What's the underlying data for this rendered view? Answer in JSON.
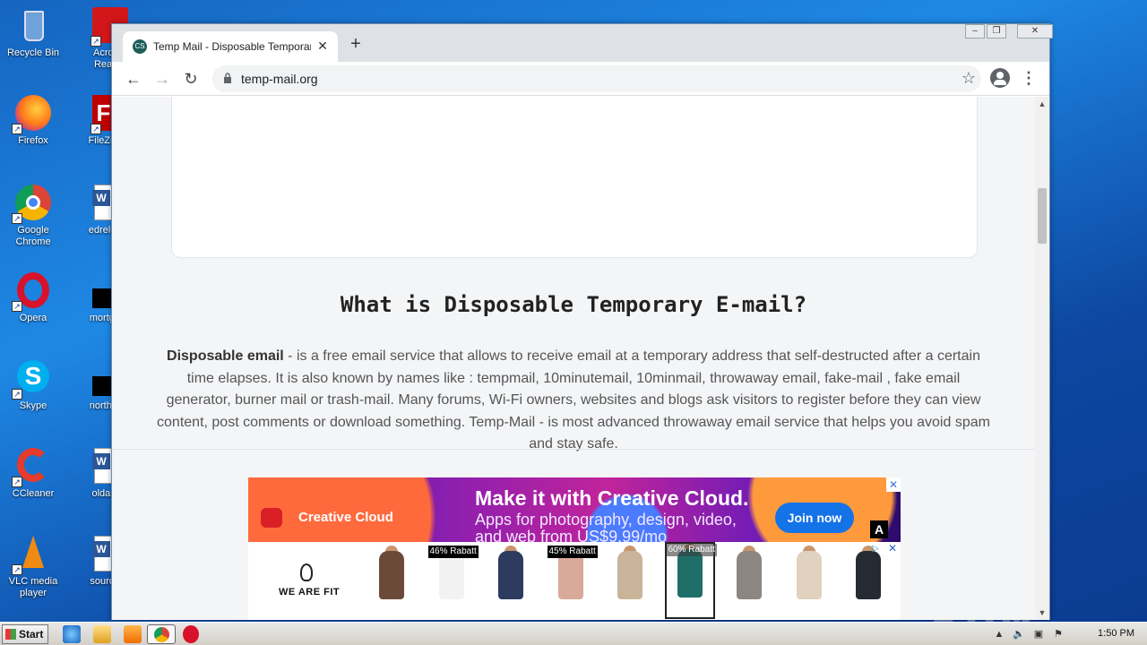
{
  "desktop": {
    "icons": [
      {
        "label": "Recycle Bin"
      },
      {
        "label": "Acrobat Reader"
      },
      {
        "label": "Firefox"
      },
      {
        "label": "FileZilla C"
      },
      {
        "label": "Google Chrome"
      },
      {
        "label": "edrelease"
      },
      {
        "label": "Opera"
      },
      {
        "label": "mortgage"
      },
      {
        "label": "Skype"
      },
      {
        "label": "northernfi"
      },
      {
        "label": "CCleaner"
      },
      {
        "label": "oldasian"
      },
      {
        "label": "VLC media player"
      },
      {
        "label": "sourcean"
      }
    ],
    "watermark": "ANY RUN"
  },
  "browser": {
    "tab_title": "Temp Mail - Disposable Temporary E",
    "favicon_text": "CS",
    "url": "temp-mail.org",
    "new_tab_label": "+",
    "close_tab_label": "✕"
  },
  "page": {
    "heading": "What is Disposable Temporary E-mail?",
    "desc_bold": "Disposable email",
    "desc_rest": " - is a free email service that allows to receive email at a temporary address that self-destructed after a certain time elapses. It is also known by names like : tempmail, 10minutemail, 10minmail, throwaway email, fake-mail , fake email generator, burner mail or trash-mail. Many forums, Wi-Fi owners, websites and blogs ask visitors to register before they can view content, post comments or download something. Temp-Mail - is most advanced throwaway email service that helps you avoid spam and stay safe."
  },
  "ad": {
    "cc_brand": "Creative Cloud",
    "headline": "Make it with Creative Cloud.",
    "subline": "Apps for photography, design, video, and web from US$9.99/mo",
    "cta": "Join now",
    "adobe_mark": "A",
    "strip_brand": "WE ARE FIT",
    "badges": [
      "46% Rabatt",
      "45% Rabatt",
      "60% Rabatt"
    ],
    "product_colors": [
      "#6b4a3a",
      "#f2f2f2",
      "#2c3b5e",
      "#d9a99a",
      "#c9b49a",
      "#1f6f68",
      "#8c8582",
      "#e0d2bf",
      "#262a33"
    ]
  },
  "taskbar": {
    "start_label": "Start",
    "clock": "1:50 PM"
  }
}
